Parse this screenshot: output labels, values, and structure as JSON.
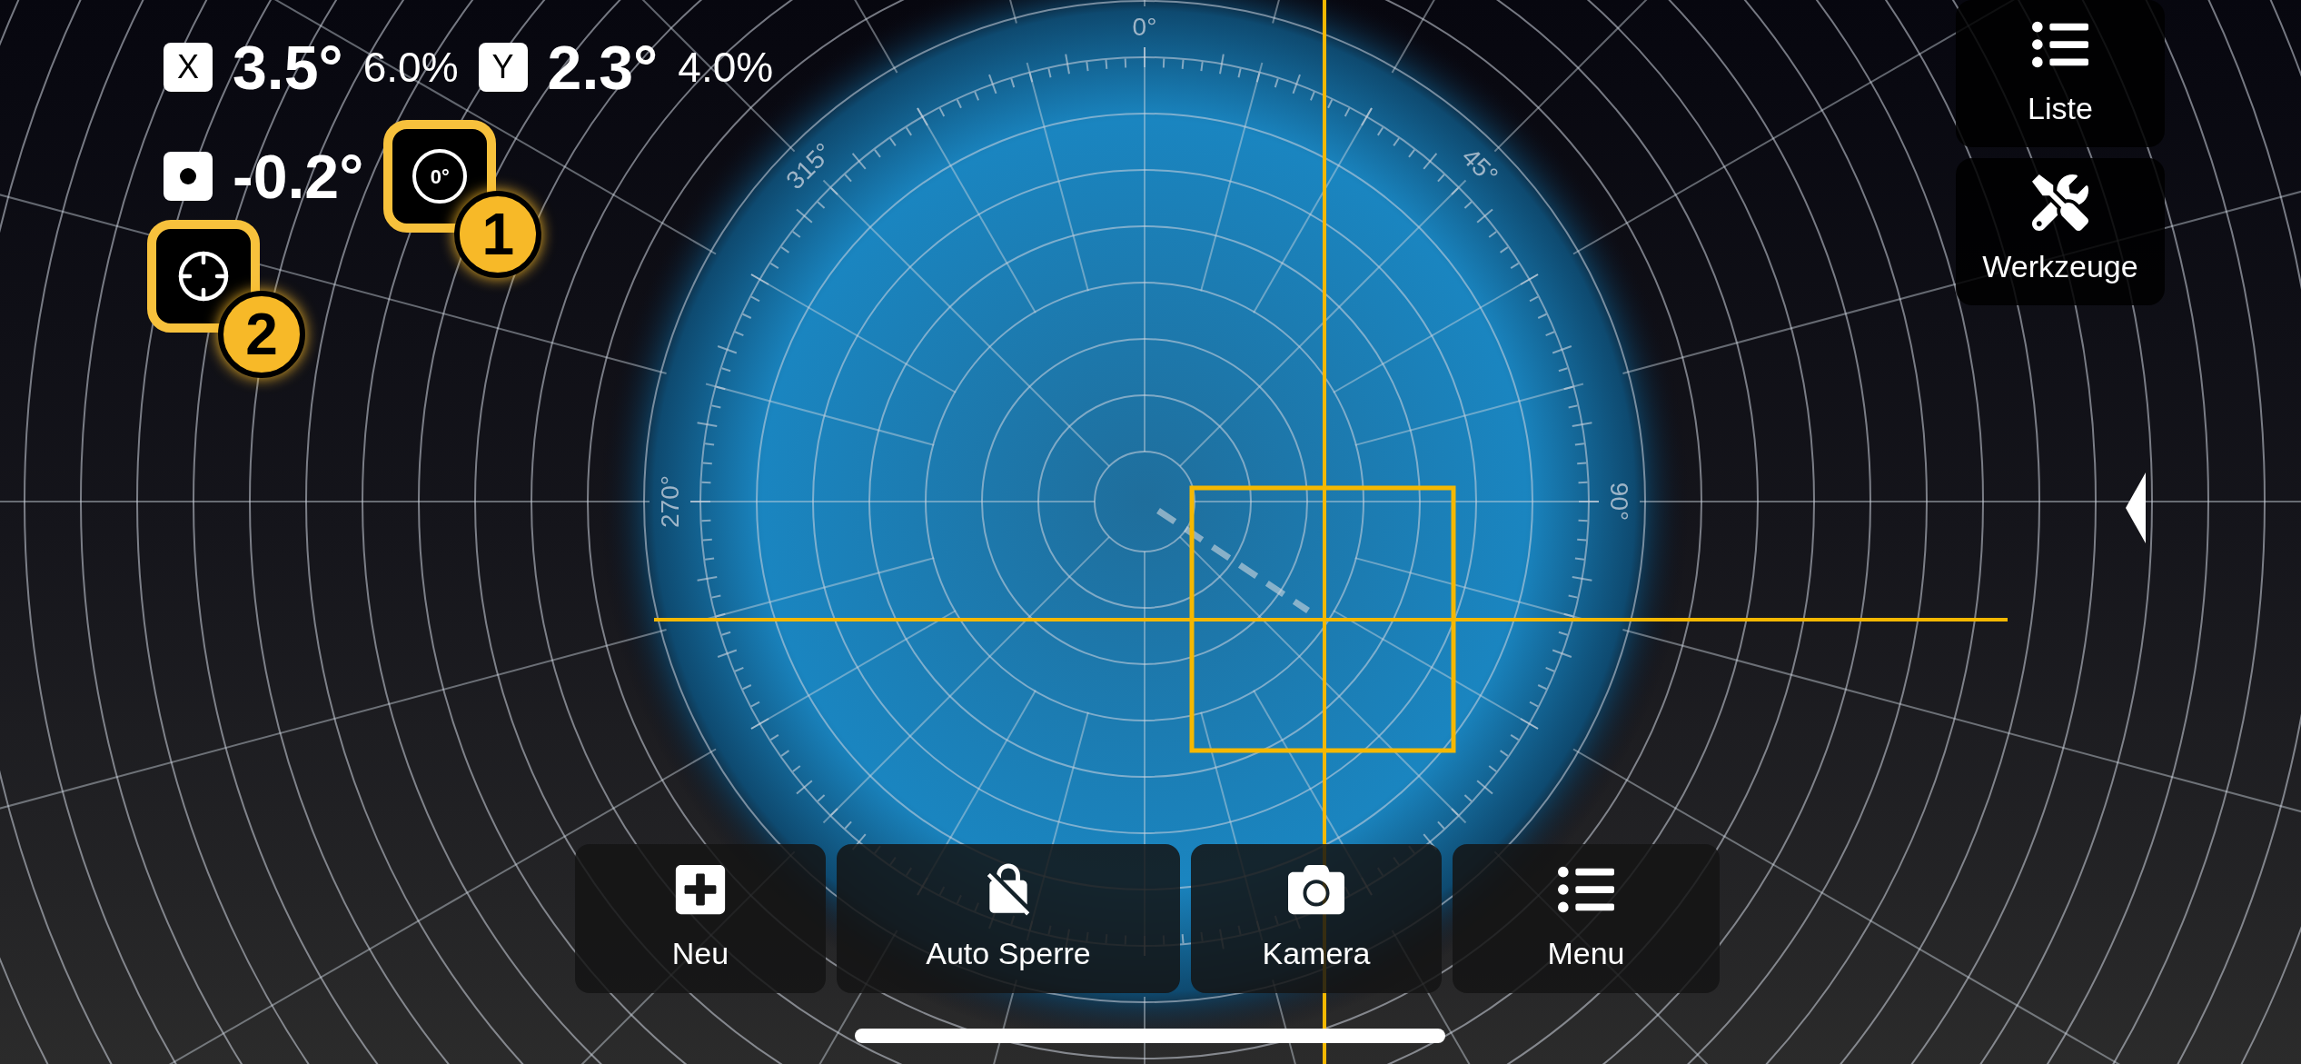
{
  "readouts": {
    "x": {
      "label": "X",
      "angle": "3.5°",
      "percent": "6.0%"
    },
    "y": {
      "label": "Y",
      "angle": "2.3°",
      "percent": "4.0%"
    },
    "roll": {
      "angle": "-0.2°"
    }
  },
  "zero_button": {
    "icon_text": "0°",
    "callout": "1",
    "highlighted": true
  },
  "target_button": {
    "callout": "2",
    "highlighted": true
  },
  "side_buttons": [
    {
      "kind": "list",
      "label": "Liste"
    },
    {
      "kind": "tools",
      "label": "Werkzeuge"
    }
  ],
  "dial": {
    "labels": [
      "0°",
      "45°",
      "90°",
      "270°",
      "315°"
    ]
  },
  "toolbar": [
    {
      "kind": "plus",
      "label": "Neu"
    },
    {
      "kind": "lock-off",
      "label": "Auto Sperre"
    },
    {
      "kind": "camera",
      "label": "Kamera"
    },
    {
      "kind": "list",
      "label": "Menu"
    }
  ]
}
